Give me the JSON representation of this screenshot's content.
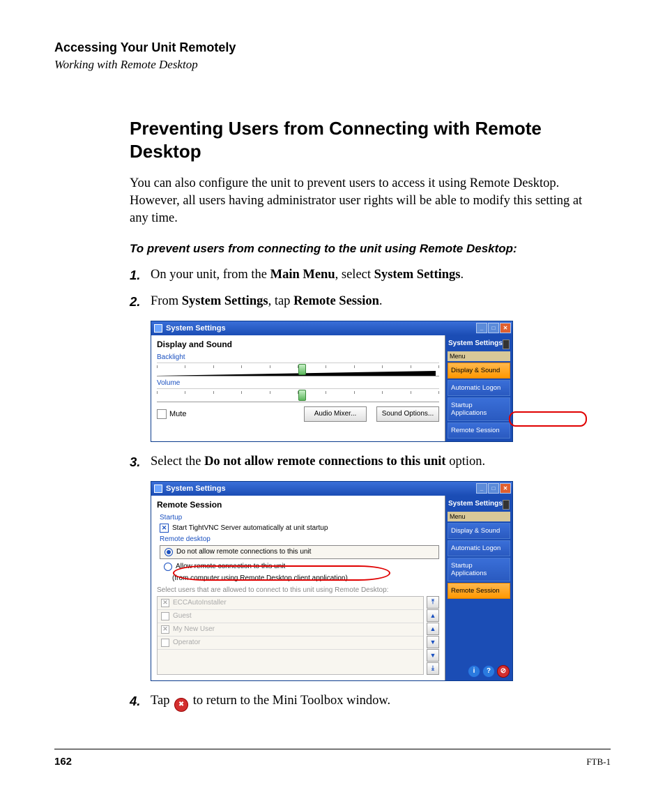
{
  "header": {
    "title": "Accessing Your Unit Remotely",
    "subtitle": "Working with Remote Desktop"
  },
  "section": {
    "title": "Preventing Users from Connecting with Remote Desktop",
    "intro": "You can also configure the unit to prevent users to access it using Remote Desktop. However, all users having administrator user rights will be able to modify this setting at any time.",
    "instruction": "To prevent users from connecting to the unit using Remote Desktop:",
    "step1_num": "1.",
    "step1_a": "On your unit, from the ",
    "step1_b": "Main Menu",
    "step1_c": ", select ",
    "step1_d": "System Settings",
    "step1_e": ".",
    "step2_num": "2.",
    "step2_a": "From ",
    "step2_b": "System Settings",
    "step2_c": ", tap ",
    "step2_d": "Remote Session",
    "step2_e": ".",
    "step3_num": "3.",
    "step3_a": "Select the ",
    "step3_b": "Do not allow remote connections to this unit",
    "step3_c": " option.",
    "step4_num": "4.",
    "step4_a": "Tap ",
    "step4_b": " to return to the Mini Toolbox window."
  },
  "shot1": {
    "title": "System Settings",
    "panel_title": "Display and Sound",
    "backlight": "Backlight",
    "volume": "Volume",
    "mute": "Mute",
    "audio_mixer": "Audio Mixer...",
    "sound_options": "Sound Options...",
    "side_title": "System Settings",
    "menu": "Menu",
    "item1": "Display & Sound",
    "item2": "Automatic Logon",
    "item3": "Startup Applications",
    "item4": "Remote Session"
  },
  "shot2": {
    "title": "System Settings",
    "panel_title": "Remote Session",
    "startup": "Startup",
    "startup_chk": "Start TightVNC Server automatically at unit startup",
    "rd": "Remote desktop",
    "opt1": "Do not allow remote connections to this unit",
    "opt2": "Allow remote connection to this unit",
    "opt2_hint": "(from computer using Remote Desktop client application)",
    "users_note": "Select users that are allowed to connect to this unit using Remote Desktop:",
    "u1": "ECCAutoInstaller",
    "u2": "Guest",
    "u3": "My New User",
    "u4": "Operator",
    "side_title": "System Settings",
    "menu": "Menu",
    "item1": "Display & Sound",
    "item2": "Automatic Logon",
    "item3": "Startup Applications",
    "item4": "Remote Session"
  },
  "footer": {
    "page": "162",
    "doc": "FTB-1"
  }
}
